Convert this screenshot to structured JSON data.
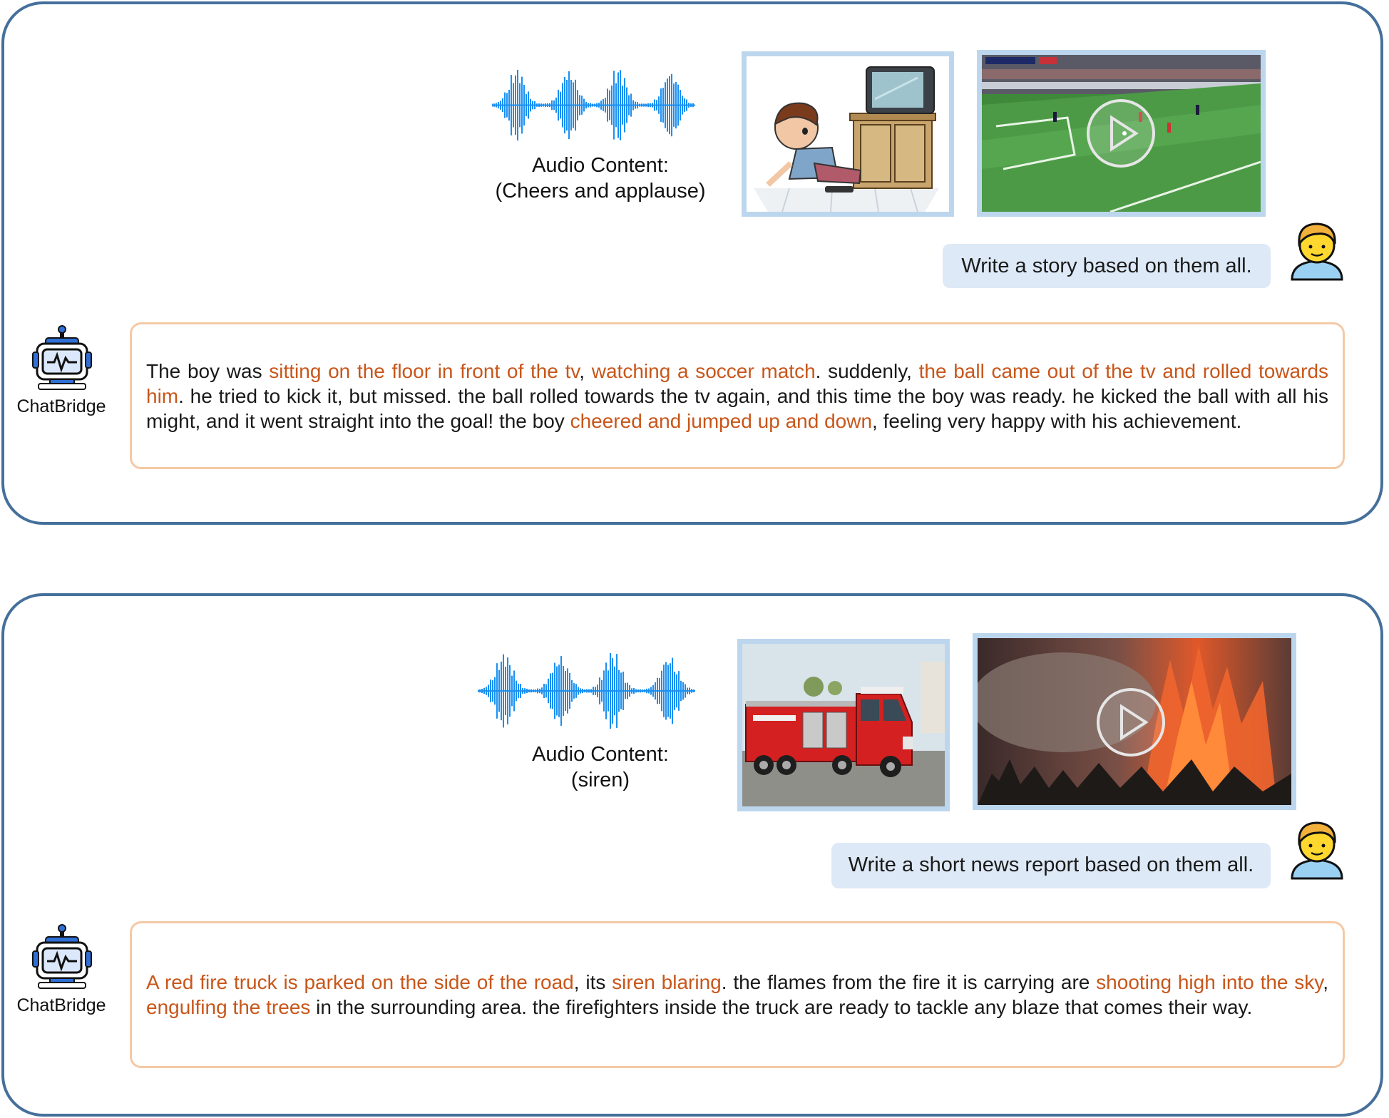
{
  "example_1": {
    "audio_caption_line1": "Audio Content:",
    "audio_caption_line2": "(Cheers and applause)",
    "image_icon": "cartoon-boy-watching-tv-image",
    "video_icon": "soccer-match-video-thumbnail",
    "user_prompt": "Write a story based on them all.",
    "bot_name": "ChatBridge",
    "response_segments": [
      {
        "text": "The boy was ",
        "highlight": false
      },
      {
        "text": "sitting on the floor in front of the tv",
        "highlight": true
      },
      {
        "text": ", ",
        "highlight": false
      },
      {
        "text": "watching a soccer match",
        "highlight": true
      },
      {
        "text": ". suddenly, ",
        "highlight": false
      },
      {
        "text": "the ball came out of the tv and rolled towards him",
        "highlight": true
      },
      {
        "text": ". he tried to kick it, but missed. the ball rolled towards the tv again, and this time the boy was ready. he kicked the ball with all his might, and it went straight into the goal! the boy ",
        "highlight": false
      },
      {
        "text": "cheered and jumped up and down",
        "highlight": true
      },
      {
        "text": ", feeling very happy with his achievement.",
        "highlight": false
      }
    ]
  },
  "example_2": {
    "audio_caption_line1": "Audio Content:",
    "audio_caption_line2": "(siren)",
    "image_icon": "red-fire-truck-photo",
    "video_icon": "forest-fire-video-thumbnail",
    "user_prompt": "Write a short news report based on them all.",
    "bot_name": "ChatBridge",
    "response_segments": [
      {
        "text": "A red fire truck is parked on the side of the road",
        "highlight": true
      },
      {
        "text": ", its ",
        "highlight": false
      },
      {
        "text": "siren blaring",
        "highlight": true
      },
      {
        "text": ". the flames from the fire it is carrying are ",
        "highlight": false
      },
      {
        "text": "shooting high into the sky",
        "highlight": true
      },
      {
        "text": ", ",
        "highlight": false
      },
      {
        "text": "engulfing the trees",
        "highlight": true
      },
      {
        "text": " in the surrounding area. the firefighters inside the truck are ready to tackle any blaze that comes their way.",
        "highlight": false
      }
    ]
  },
  "colors": {
    "panel_border": "#45709b",
    "waveform": "#1b8ff0",
    "media_border": "#bcd6ee",
    "user_bubble": "#dde9f6",
    "response_border": "#f4c9a5",
    "highlight_text": "#c8561a",
    "robot_blue": "#2f6fd6"
  }
}
